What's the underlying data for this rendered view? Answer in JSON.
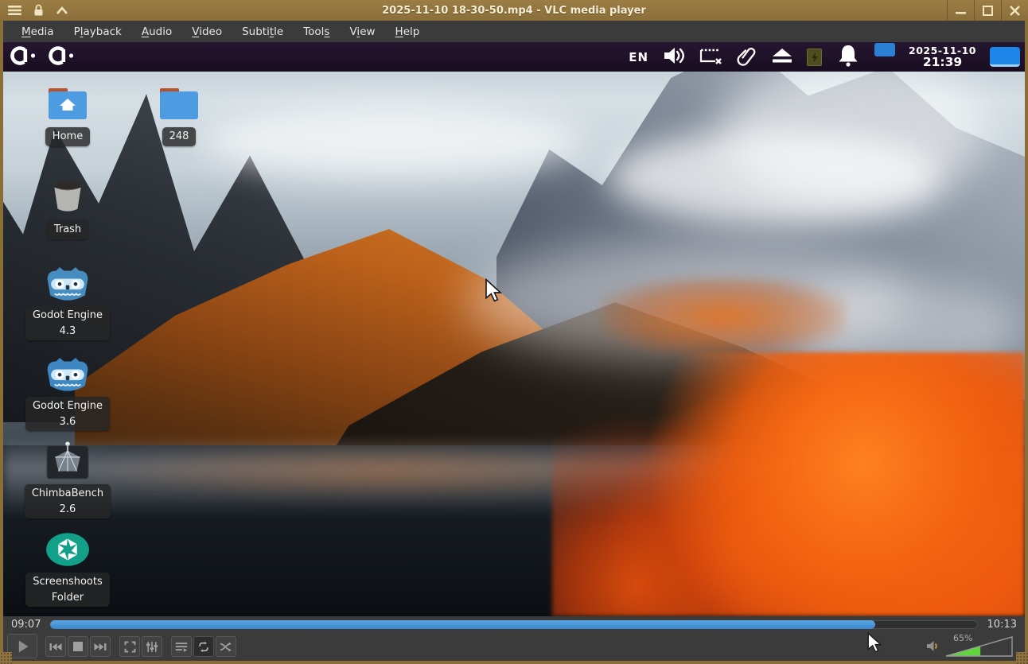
{
  "window": {
    "title": "2025-11-10 18-30-50.mp4 - VLC media player",
    "titlebar_icons": [
      "window-menu",
      "lock",
      "shade-up"
    ],
    "window_buttons": [
      "minimize",
      "maximize",
      "close"
    ],
    "titlebar_color": "#8f7340"
  },
  "menu_bar": {
    "items": [
      {
        "label": "Media",
        "underline": 0
      },
      {
        "label": "Playback",
        "underline": 1
      },
      {
        "label": "Audio",
        "underline": 0
      },
      {
        "label": "Video",
        "underline": 0
      },
      {
        "label": "Subtitle",
        "underline": 5
      },
      {
        "label": "Tools",
        "underline": 4
      },
      {
        "label": "View",
        "underline": 1
      },
      {
        "label": "Help",
        "underline": 0
      }
    ]
  },
  "video_content": {
    "description": "screen recording of a desktop with mountain-autumn wallpaper",
    "panel": {
      "language": "EN",
      "date": "2025-11-10",
      "time": "21:39",
      "left_icons": [
        "app-logo",
        "app-logo"
      ],
      "right_icons": [
        "volume",
        "screenshot-region",
        "paperclip",
        "eject",
        "battery",
        "notifications-bell",
        "tray-blue",
        "clock",
        "display-blue"
      ]
    },
    "desktop_icons": [
      {
        "name": "home",
        "lines": [
          "Home"
        ]
      },
      {
        "name": "folder-248",
        "lines": [
          "248"
        ]
      },
      {
        "name": "trash",
        "lines": [
          "Trash"
        ]
      },
      {
        "name": "godot-4-3",
        "lines": [
          "Godot Engine",
          "4.3"
        ]
      },
      {
        "name": "godot-3-6",
        "lines": [
          "Godot Engine",
          "3.6"
        ]
      },
      {
        "name": "chimbabench",
        "lines": [
          "ChimbaBench",
          "2.6"
        ]
      },
      {
        "name": "screenshoots",
        "lines": [
          "Screenshoots",
          "Folder"
        ]
      }
    ]
  },
  "transport": {
    "elapsed": "09:07",
    "duration": "10:13",
    "progress_percent": 89,
    "buttons": [
      "play",
      "previous",
      "stop",
      "next",
      "fullscreen",
      "extended-settings",
      "playlist",
      "loop",
      "random"
    ]
  },
  "volume": {
    "label": "65%",
    "percent": 65,
    "max_percent": 125,
    "fill_color": "#5fd43c"
  },
  "colors": {
    "chrome_bg": "#3b3b3b",
    "seek_fill": "#3e8ed0",
    "panel_bg": "#1d1026",
    "folder_blue": "#4d9be0",
    "accent_blue": "#1e86e8"
  }
}
